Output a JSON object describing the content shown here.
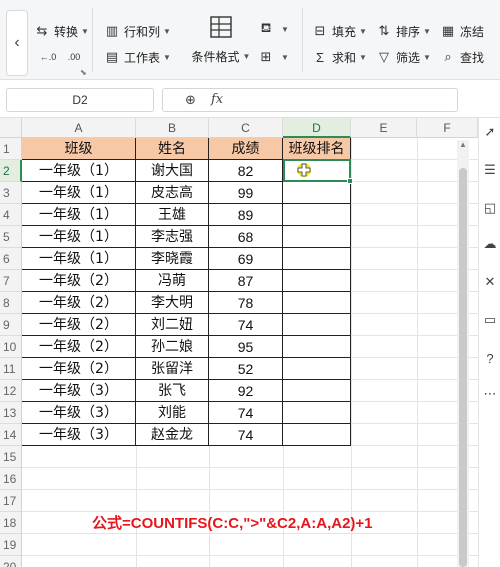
{
  "ribbon": {
    "convert_label": "转换",
    "rows_cols_label": "行和列",
    "worksheet_label": "工作表",
    "cond_format_label": "条件格式",
    "fill_label": "填充",
    "sort_label": "排序",
    "freeze_label": "冻结",
    "sum_label": "求和",
    "filter_label": "筛选",
    "find_label": "查找"
  },
  "formula_bar": {
    "name_box": "D2",
    "fx": "fx"
  },
  "columns": [
    "A",
    "B",
    "C",
    "D",
    "E",
    "F"
  ],
  "rows": [
    "1",
    "2",
    "3",
    "4",
    "5",
    "6",
    "7",
    "8",
    "9",
    "10",
    "11",
    "12",
    "13",
    "14",
    "15",
    "16",
    "17",
    "18",
    "19",
    "20"
  ],
  "table": {
    "headers": [
      "班级",
      "姓名",
      "成绩",
      "班级排名"
    ],
    "rows": [
      [
        "一年级（1）",
        "谢大国",
        "82",
        ""
      ],
      [
        "一年级（1）",
        "皮志高",
        "99",
        ""
      ],
      [
        "一年级（1）",
        "王雄",
        "89",
        ""
      ],
      [
        "一年级（1）",
        "李志强",
        "68",
        ""
      ],
      [
        "一年级（1）",
        "李晓霞",
        "69",
        ""
      ],
      [
        "一年级（2）",
        "冯萌",
        "87",
        ""
      ],
      [
        "一年级（2）",
        "李大明",
        "78",
        ""
      ],
      [
        "一年级（2）",
        "刘二妞",
        "74",
        ""
      ],
      [
        "一年级（2）",
        "孙二娘",
        "95",
        ""
      ],
      [
        "一年级（2）",
        "张留洋",
        "52",
        ""
      ],
      [
        "一年级（3）",
        "张飞",
        "92",
        ""
      ],
      [
        "一年级（3）",
        "刘能",
        "74",
        ""
      ],
      [
        "一年级（3）",
        "赵金龙",
        "74",
        ""
      ]
    ]
  },
  "active_cell": "D2",
  "formula_note": "公式=COUNTIFS(C:C,\">\"&C2,A:A,A2)+1",
  "colors": {
    "header_fill": "#f7c8a6",
    "selection": "#2e8b57",
    "note": "#e8161b"
  }
}
